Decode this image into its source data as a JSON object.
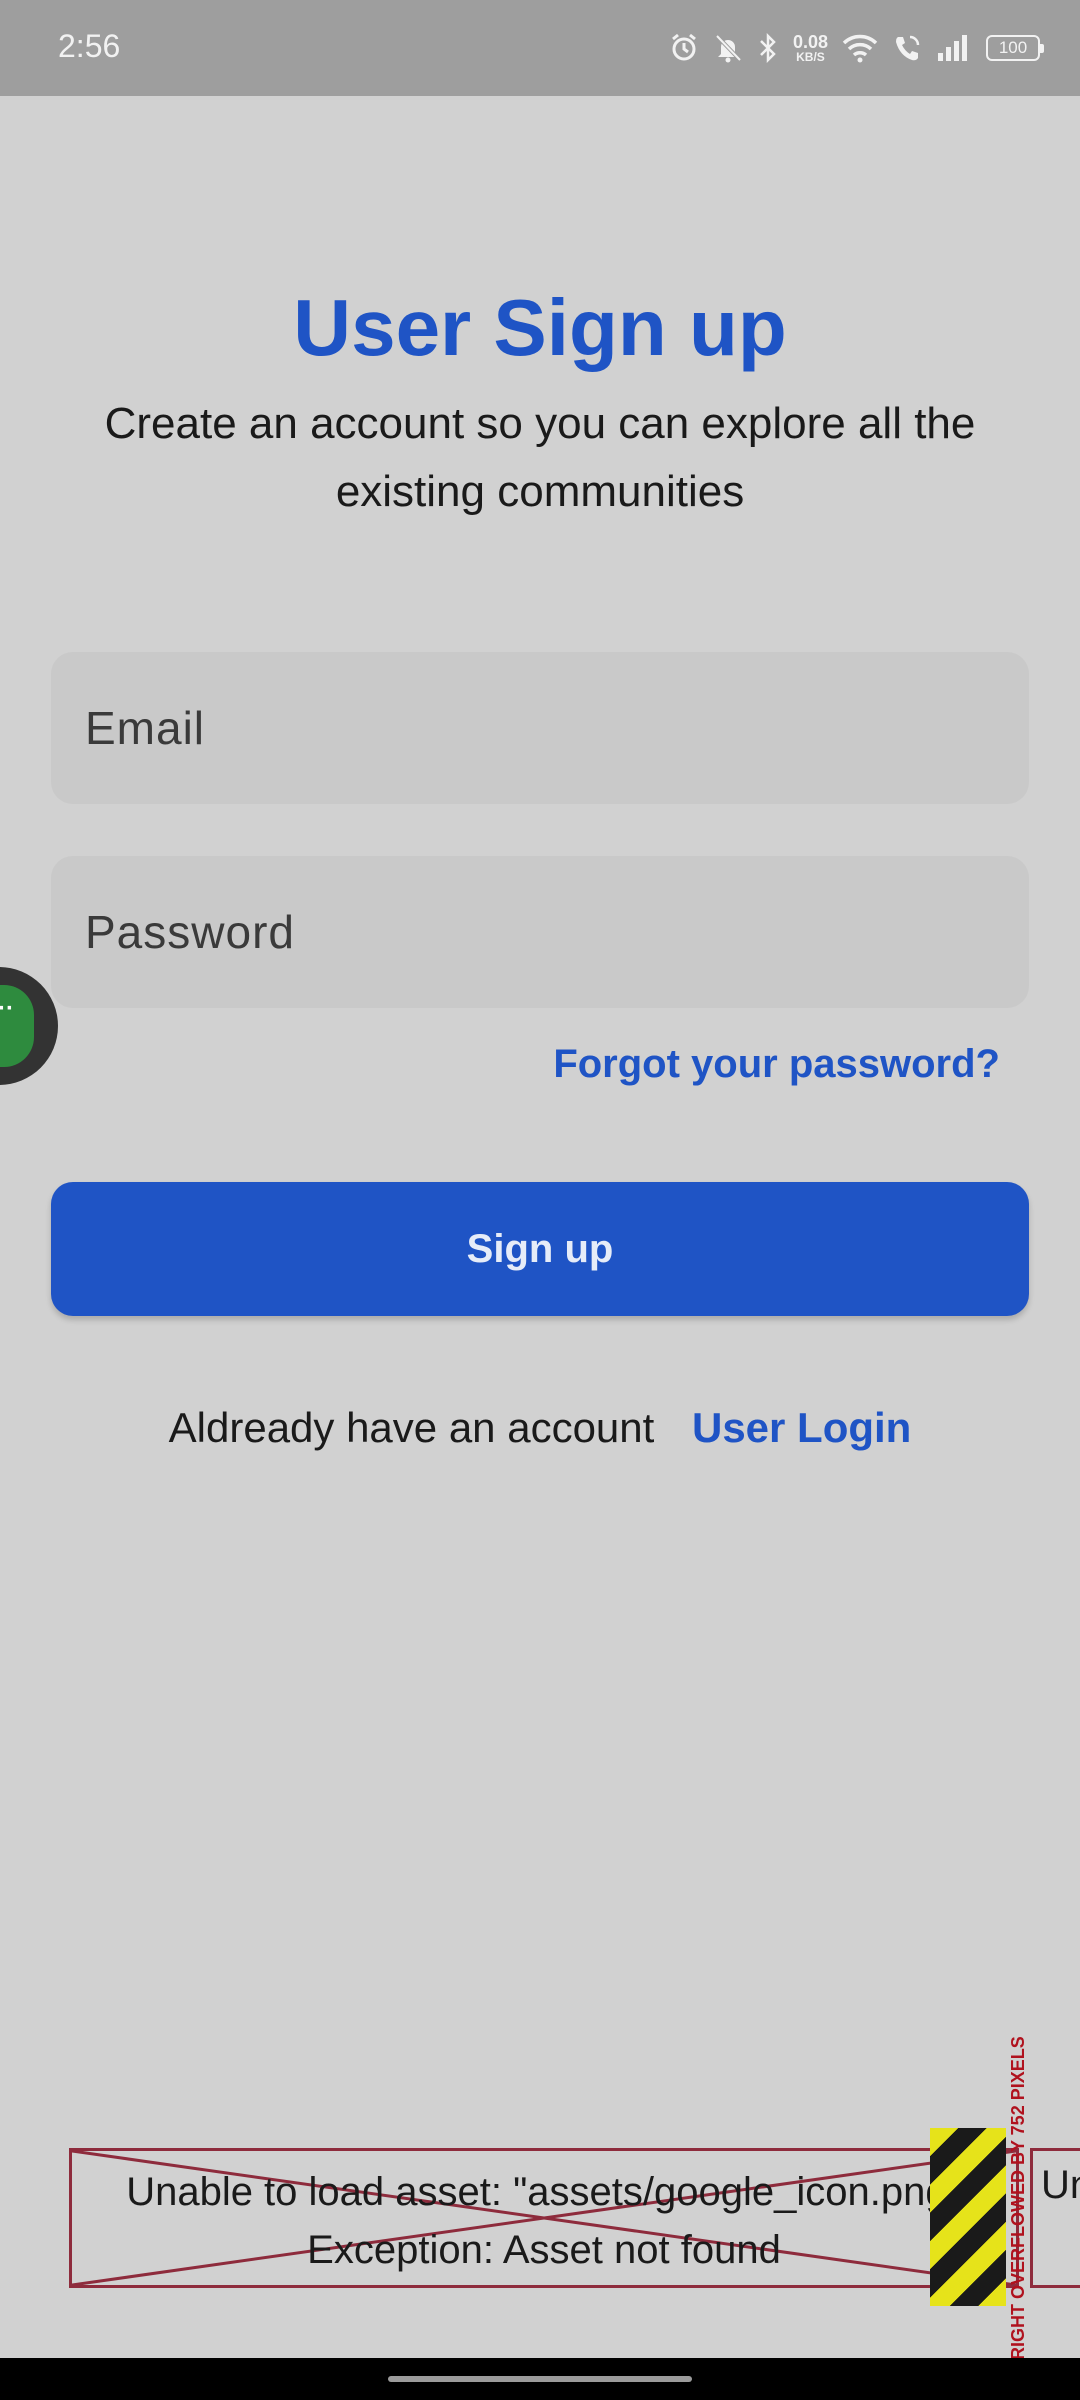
{
  "status_bar": {
    "time": "2:56",
    "net_speed": "0.08",
    "net_unit": "KB/S",
    "battery": "100",
    "icons": [
      "alarm-icon",
      "mute-icon",
      "bluetooth-icon",
      "wifi-icon",
      "call-icon",
      "signal-icon",
      "battery-icon"
    ]
  },
  "page": {
    "title": "User Sign up",
    "subtitle": "Create an account so you can explore all the existing communities"
  },
  "form": {
    "email_placeholder": "Email",
    "password_placeholder": "Password",
    "forgot_label": "Forgot your password?",
    "signup_label": "Sign up"
  },
  "footer": {
    "prompt": "Aldready have an account",
    "login_link": "User Login"
  },
  "error": {
    "line1": "Unable to load asset: \"assets/google_icon.png\"",
    "line2": "Exception: Asset not found",
    "cut_text": "Un",
    "overflow_label": "RIGHT OVERFLOWED BY 752 PIXELS"
  },
  "colors": {
    "accent": "#1f54c5",
    "background": "#d1d1d1",
    "field_bg": "#c9c9c9",
    "status_bar": "#9e9e9e",
    "error_border": "#8e2b3c"
  }
}
